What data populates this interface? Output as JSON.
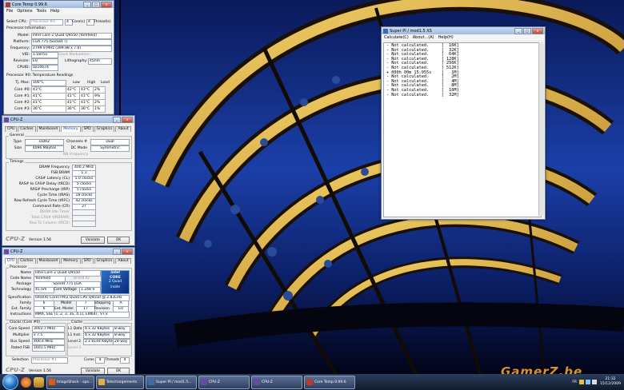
{
  "coretemp": {
    "title": "Core Temp 0.99.6",
    "menu": [
      "File",
      "Options",
      "Tools",
      "Help"
    ],
    "select_label": "Select CPU:",
    "select_value": "Processor #0",
    "cores_count": "4",
    "cores_label": "Core(s)",
    "threads_count": "4",
    "threads_label": "Thread(s)",
    "proc_info_title": "Processor Information",
    "model_label": "Model:",
    "model_value": "Intel Core 2 Quad Q9550 (Yorkfield)",
    "platform_label": "Platform:",
    "platform_value": "LGA 775 (Socket T)",
    "frequency_label": "Frequency:",
    "frequency_value": "2799.9 MHz (399.98 x 7.0)",
    "vid_label": "VID:",
    "vid_value": "1.1875v",
    "clock_mod_label": "Clock Modulation:",
    "revision_label": "Revision:",
    "revision_value": "E0",
    "litho_label": "Lithography:",
    "litho_value": "45nm",
    "cpuid_label": "CPUID:",
    "cpuid_value": "0x10674",
    "temps_title": "Processor #0: Temperature Readings",
    "tj_label": "Tj. Max:",
    "tj_value": "100°C",
    "col_low": "Low",
    "col_high": "High",
    "col_load": "Load",
    "cores": [
      {
        "label": "Core #0:",
        "temp": "43°C",
        "low": "42°C",
        "high": "43°C",
        "load": "2%"
      },
      {
        "label": "Core #1:",
        "temp": "41°C",
        "low": "41°C",
        "high": "41°C",
        "load": "9%"
      },
      {
        "label": "Core #2:",
        "temp": "41°C",
        "low": "41°C",
        "high": "41°C",
        "load": "2%"
      },
      {
        "label": "Core #3:",
        "temp": "36°C",
        "low": "36°C",
        "high": "36°C",
        "load": "1%"
      }
    ]
  },
  "cpuz_mem": {
    "title": "CPU-Z",
    "tabs": [
      "CPU",
      "Caches",
      "Mainboard",
      "Memory",
      "SPD",
      "Graphics",
      "About"
    ],
    "active_tab": "Memory",
    "general_title": "General",
    "type_label": "Type",
    "type_value": "DDR2",
    "channels_label": "Channels #",
    "channels_value": "Dual",
    "size_label": "Size",
    "size_value": "4096 MBytes",
    "dc_label": "DC Mode",
    "dc_value": "Symmetric",
    "nb_label": "NB Frequency",
    "timings_title": "Timings",
    "timings": [
      {
        "label": "DRAM Frequency",
        "value": "400.2 MHz"
      },
      {
        "label": "FSB:DRAM",
        "value": "1:1"
      },
      {
        "label": "CAS# Latency (CL)",
        "value": "5.0 clocks"
      },
      {
        "label": "RAS# to CAS# Delay (tRCD)",
        "value": "5 clocks"
      },
      {
        "label": "RAS# Precharge (tRP)",
        "value": "5 clocks"
      },
      {
        "label": "Cycle Time (tRAS)",
        "value": "18 clocks"
      },
      {
        "label": "Row Refresh Cycle Time (tRFC)",
        "value": "42 clocks"
      },
      {
        "label": "Command Rate (CR)",
        "value": "2T"
      },
      {
        "label": "DRAM Idle Timer",
        "value": ""
      },
      {
        "label": "Total CAS# (tRDRAM)",
        "value": ""
      },
      {
        "label": "Row To Column (tRCD)",
        "value": ""
      }
    ],
    "brand": "CPU-Z",
    "version": "Version 1.56",
    "validate": "Validate",
    "ok": "OK"
  },
  "cpuz_cpu": {
    "title": "CPU-Z",
    "tabs": [
      "CPU",
      "Caches",
      "Mainboard",
      "Memory",
      "SPD",
      "Graphics",
      "About"
    ],
    "active_tab": "CPU",
    "processor_title": "Processor",
    "name_label": "Name",
    "name_value": "Intel Core 2 Quad Q9550",
    "codename_label": "Code Name",
    "codename_value": "Yorkfield",
    "brandid_label": "Brand ID",
    "package_label": "Package",
    "package_value": "Socket 775 LGA",
    "tech_label": "Technology",
    "tech_value": "45 nm",
    "voltage_label": "Core Voltage",
    "voltage_value": "1.248 V",
    "spec_label": "Specification",
    "spec_value": "Intel(R) Core(TM)2 Quad CPU   Q9550 @ 2.83GHz",
    "family_label": "Family",
    "family_value": "6",
    "model_label": "Model",
    "model_value": "7",
    "stepping_label": "Stepping",
    "stepping_value": "A",
    "extfamily_label": "Ext. Family",
    "extfamily_value": "6",
    "extmodel_label": "Ext. Model",
    "extmodel_value": "17",
    "revision_label": "Revision",
    "revision_value": "E0",
    "instr_label": "Instructions",
    "instr_value": "MMX, SSE (1, 2, 3, 3S, 4.1), EM64T, VT-x",
    "clocks_title": "Clocks (Core #0)",
    "corespeed_label": "Core Speed",
    "corespeed_value": "3002.7 MHz",
    "multiplier_label": "Multiplier",
    "multiplier_value": "x 7.5",
    "busspeed_label": "Bus Speed",
    "busspeed_value": "400.4 MHz",
    "ratedfsb_label": "Rated FSB",
    "ratedfsb_value": "1601.5 MHz",
    "cache_title": "Cache",
    "l1d_label": "L1 Data",
    "l1d_value": "4 x 32 KBytes",
    "l1d_way": "8-way",
    "l1i_label": "L1 Inst.",
    "l1i_value": "4 x 32 KBytes",
    "l1i_way": "8-way",
    "l2_label": "Level 2",
    "l2_value": "2 x 6144 KBytes",
    "l2_way": "24-way",
    "l3_label": "Level 3",
    "selection_label": "Selection",
    "selection_value": "Processor #1",
    "cores_label": "Cores",
    "cores_value": "4",
    "threads_label": "Threads",
    "threads_value": "4",
    "intel_badge_1": "intel",
    "intel_badge_2": "CORE",
    "intel_badge_3": "2 Quad",
    "intel_badge_4": "inside",
    "brand": "CPU-Z",
    "version": "Version 1.56",
    "validate": "Validate",
    "ok": "OK"
  },
  "superpi": {
    "title": "Super PI / mod1.5 XS",
    "menu": [
      "Calculate(C)",
      "About...(A)",
      "Help(H)"
    ],
    "lines": [
      "- Not calculated.     [  16K]",
      "- Not calculated.     [  32K]",
      "- Not calculated.     [  64K]",
      "- Not calculated.     [ 128K]",
      "- Not calculated.     [ 256K]",
      "- Not calculated.     [ 512K]",
      "+ 000h 00m 15.955s    [   1M]",
      "- Not calculated.     [   2M]",
      "- Not calculated.     [   4M]",
      "- Not calculated.     [   8M]",
      "- Not calculated.     [  16M]",
      "- Not calculated.     [  32M]"
    ]
  },
  "taskbar": {
    "items": [
      {
        "label": "ImageShack - spe...",
        "color": "#d85a1a"
      },
      {
        "label": "Telechargements",
        "color": "#e0b040"
      },
      {
        "label": "Super PI / mod1.5...",
        "color": "#3a6ea8"
      },
      {
        "label": "CPU-Z",
        "color": "#6a4aa0"
      },
      {
        "label": "CPU-Z",
        "color": "#6a4aa0"
      },
      {
        "label": "Core Temp 0.99.6",
        "color": "#b83a2a"
      }
    ],
    "lang": "FR",
    "time": "21:32",
    "date": "15/12/2009"
  },
  "watermark": "GamerZ.be"
}
